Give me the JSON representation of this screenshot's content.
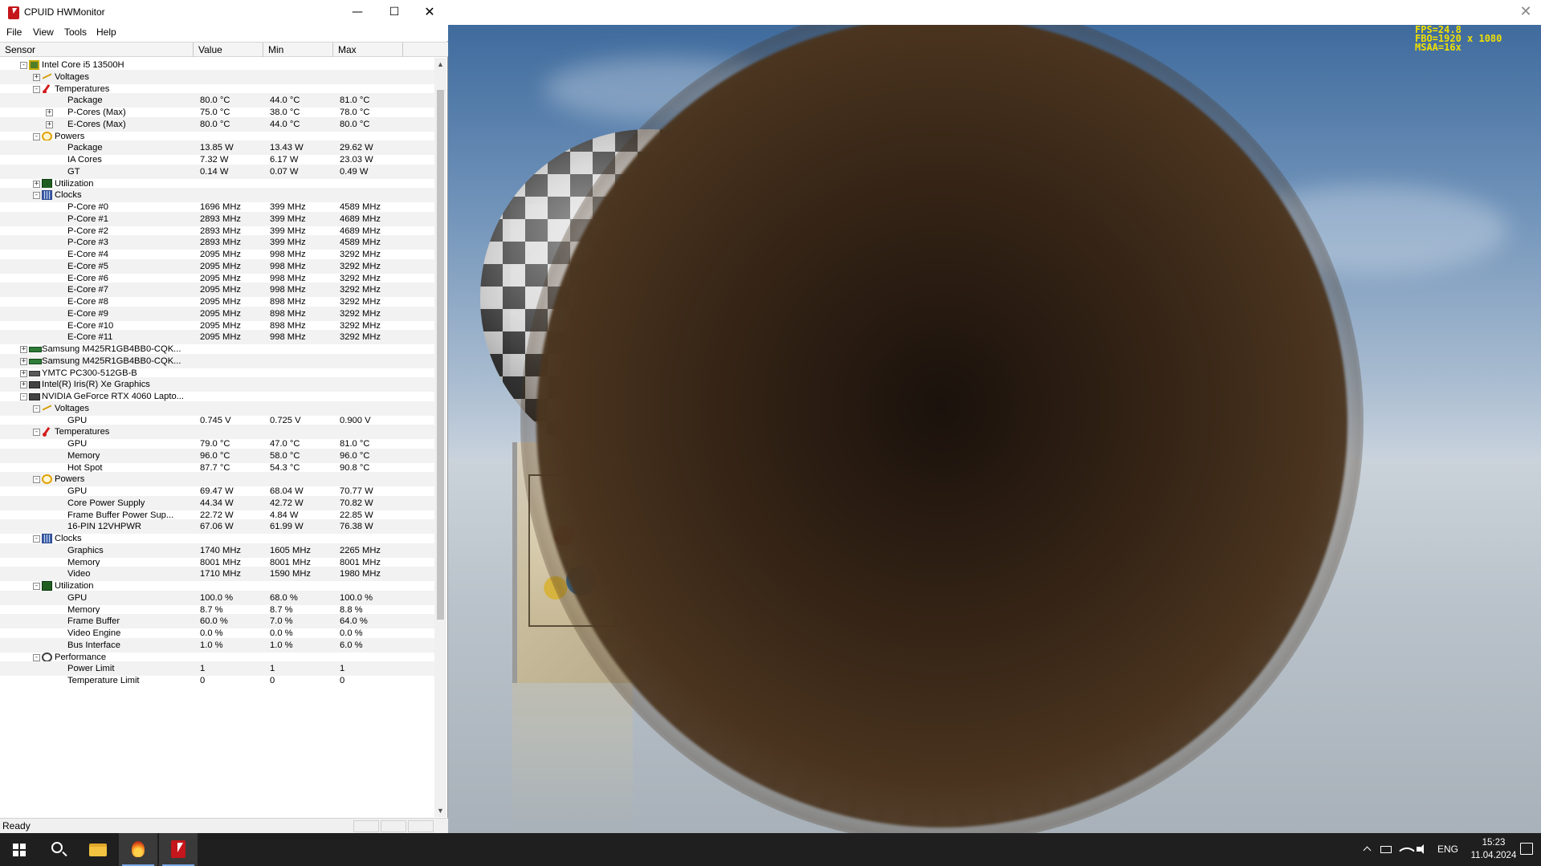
{
  "hwmonitor": {
    "title": "CPUID HWMonitor",
    "window_buttons": {
      "minimize": "—",
      "maximize": "☐",
      "close": "✕"
    },
    "menu": [
      "File",
      "View",
      "Tools",
      "Help"
    ],
    "columns": [
      "Sensor",
      "Value",
      "Min",
      "Max"
    ],
    "rows": [
      {
        "level": 1,
        "exp": "-",
        "icon": "cpu",
        "label": "Intel Core i5 13500H",
        "value": "",
        "min": "",
        "max": ""
      },
      {
        "level": 2,
        "exp": "+",
        "icon": "volt",
        "label": "Voltages",
        "value": "",
        "min": "",
        "max": ""
      },
      {
        "level": 2,
        "exp": "-",
        "icon": "temp",
        "label": "Temperatures",
        "value": "",
        "min": "",
        "max": ""
      },
      {
        "level": 3,
        "exp": "",
        "icon": "",
        "label": "Package",
        "value": "80.0 °C",
        "min": "44.0 °C",
        "max": "81.0 °C"
      },
      {
        "level": 3,
        "exp": "+",
        "icon": "",
        "label": "P-Cores (Max)",
        "value": "75.0 °C",
        "min": "38.0 °C",
        "max": "78.0 °C"
      },
      {
        "level": 3,
        "exp": "+",
        "icon": "",
        "label": "E-Cores (Max)",
        "value": "80.0 °C",
        "min": "44.0 °C",
        "max": "80.0 °C"
      },
      {
        "level": 2,
        "exp": "-",
        "icon": "power",
        "label": "Powers",
        "value": "",
        "min": "",
        "max": ""
      },
      {
        "level": 3,
        "exp": "",
        "icon": "",
        "label": "Package",
        "value": "13.85 W",
        "min": "13.43 W",
        "max": "29.62 W"
      },
      {
        "level": 3,
        "exp": "",
        "icon": "",
        "label": "IA Cores",
        "value": "7.32 W",
        "min": "6.17 W",
        "max": "23.03 W"
      },
      {
        "level": 3,
        "exp": "",
        "icon": "",
        "label": "GT",
        "value": "0.14 W",
        "min": "0.07 W",
        "max": "0.49 W"
      },
      {
        "level": 2,
        "exp": "+",
        "icon": "util",
        "label": "Utilization",
        "value": "",
        "min": "",
        "max": ""
      },
      {
        "level": 2,
        "exp": "-",
        "icon": "clock",
        "label": "Clocks",
        "value": "",
        "min": "",
        "max": ""
      },
      {
        "level": 3,
        "exp": "",
        "icon": "",
        "label": "P-Core #0",
        "value": "1696 MHz",
        "min": "399 MHz",
        "max": "4589 MHz"
      },
      {
        "level": 3,
        "exp": "",
        "icon": "",
        "label": "P-Core #1",
        "value": "2893 MHz",
        "min": "399 MHz",
        "max": "4689 MHz"
      },
      {
        "level": 3,
        "exp": "",
        "icon": "",
        "label": "P-Core #2",
        "value": "2893 MHz",
        "min": "399 MHz",
        "max": "4689 MHz"
      },
      {
        "level": 3,
        "exp": "",
        "icon": "",
        "label": "P-Core #3",
        "value": "2893 MHz",
        "min": "399 MHz",
        "max": "4589 MHz"
      },
      {
        "level": 3,
        "exp": "",
        "icon": "",
        "label": "E-Core #4",
        "value": "2095 MHz",
        "min": "998 MHz",
        "max": "3292 MHz"
      },
      {
        "level": 3,
        "exp": "",
        "icon": "",
        "label": "E-Core #5",
        "value": "2095 MHz",
        "min": "998 MHz",
        "max": "3292 MHz"
      },
      {
        "level": 3,
        "exp": "",
        "icon": "",
        "label": "E-Core #6",
        "value": "2095 MHz",
        "min": "998 MHz",
        "max": "3292 MHz"
      },
      {
        "level": 3,
        "exp": "",
        "icon": "",
        "label": "E-Core #7",
        "value": "2095 MHz",
        "min": "998 MHz",
        "max": "3292 MHz"
      },
      {
        "level": 3,
        "exp": "",
        "icon": "",
        "label": "E-Core #8",
        "value": "2095 MHz",
        "min": "898 MHz",
        "max": "3292 MHz"
      },
      {
        "level": 3,
        "exp": "",
        "icon": "",
        "label": "E-Core #9",
        "value": "2095 MHz",
        "min": "898 MHz",
        "max": "3292 MHz"
      },
      {
        "level": 3,
        "exp": "",
        "icon": "",
        "label": "E-Core #10",
        "value": "2095 MHz",
        "min": "898 MHz",
        "max": "3292 MHz"
      },
      {
        "level": 3,
        "exp": "",
        "icon": "",
        "label": "E-Core #11",
        "value": "2095 MHz",
        "min": "998 MHz",
        "max": "3292 MHz"
      },
      {
        "level": 1,
        "exp": "+",
        "icon": "ram",
        "label": "Samsung M425R1GB4BB0-CQK...",
        "value": "",
        "min": "",
        "max": ""
      },
      {
        "level": 1,
        "exp": "+",
        "icon": "ram",
        "label": "Samsung M425R1GB4BB0-CQK...",
        "value": "",
        "min": "",
        "max": ""
      },
      {
        "level": 1,
        "exp": "+",
        "icon": "disk",
        "label": "YMTC PC300-512GB-B",
        "value": "",
        "min": "",
        "max": ""
      },
      {
        "level": 1,
        "exp": "+",
        "icon": "gpu",
        "label": "Intel(R) Iris(R) Xe Graphics",
        "value": "",
        "min": "",
        "max": ""
      },
      {
        "level": 1,
        "exp": "-",
        "icon": "gpu",
        "label": "NVIDIA GeForce RTX 4060 Lapto...",
        "value": "",
        "min": "",
        "max": ""
      },
      {
        "level": 2,
        "exp": "-",
        "icon": "volt",
        "label": "Voltages",
        "value": "",
        "min": "",
        "max": ""
      },
      {
        "level": 3,
        "exp": "",
        "icon": "",
        "label": "GPU",
        "value": "0.745 V",
        "min": "0.725 V",
        "max": "0.900 V"
      },
      {
        "level": 2,
        "exp": "-",
        "icon": "temp",
        "label": "Temperatures",
        "value": "",
        "min": "",
        "max": ""
      },
      {
        "level": 3,
        "exp": "",
        "icon": "",
        "label": "GPU",
        "value": "79.0 °C",
        "min": "47.0 °C",
        "max": "81.0 °C"
      },
      {
        "level": 3,
        "exp": "",
        "icon": "",
        "label": "Memory",
        "value": "96.0 °C",
        "min": "58.0 °C",
        "max": "96.0 °C"
      },
      {
        "level": 3,
        "exp": "",
        "icon": "",
        "label": "Hot Spot",
        "value": "87.7 °C",
        "min": "54.3 °C",
        "max": "90.8 °C"
      },
      {
        "level": 2,
        "exp": "-",
        "icon": "power",
        "label": "Powers",
        "value": "",
        "min": "",
        "max": ""
      },
      {
        "level": 3,
        "exp": "",
        "icon": "",
        "label": "GPU",
        "value": "69.47 W",
        "min": "68.04 W",
        "max": "70.77 W"
      },
      {
        "level": 3,
        "exp": "",
        "icon": "",
        "label": "Core Power Supply",
        "value": "44.34 W",
        "min": "42.72 W",
        "max": "70.82 W"
      },
      {
        "level": 3,
        "exp": "",
        "icon": "",
        "label": "Frame Buffer Power Sup...",
        "value": "22.72 W",
        "min": "4.84 W",
        "max": "22.85 W"
      },
      {
        "level": 3,
        "exp": "",
        "icon": "",
        "label": "16-PIN 12VHPWR",
        "value": "67.06 W",
        "min": "61.99 W",
        "max": "76.38 W"
      },
      {
        "level": 2,
        "exp": "-",
        "icon": "clock",
        "label": "Clocks",
        "value": "",
        "min": "",
        "max": ""
      },
      {
        "level": 3,
        "exp": "",
        "icon": "",
        "label": "Graphics",
        "value": "1740 MHz",
        "min": "1605 MHz",
        "max": "2265 MHz"
      },
      {
        "level": 3,
        "exp": "",
        "icon": "",
        "label": "Memory",
        "value": "8001 MHz",
        "min": "8001 MHz",
        "max": "8001 MHz"
      },
      {
        "level": 3,
        "exp": "",
        "icon": "",
        "label": "Video",
        "value": "1710 MHz",
        "min": "1590 MHz",
        "max": "1980 MHz"
      },
      {
        "level": 2,
        "exp": "-",
        "icon": "util",
        "label": "Utilization",
        "value": "",
        "min": "",
        "max": ""
      },
      {
        "level": 3,
        "exp": "",
        "icon": "",
        "label": "GPU",
        "value": "100.0 %",
        "min": "68.0 %",
        "max": "100.0 %"
      },
      {
        "level": 3,
        "exp": "",
        "icon": "",
        "label": "Memory",
        "value": "8.7 %",
        "min": "8.7 %",
        "max": "8.8 %"
      },
      {
        "level": 3,
        "exp": "",
        "icon": "",
        "label": "Frame Buffer",
        "value": "60.0 %",
        "min": "7.0 %",
        "max": "64.0 %"
      },
      {
        "level": 3,
        "exp": "",
        "icon": "",
        "label": "Video Engine",
        "value": "0.0 %",
        "min": "0.0 %",
        "max": "0.0 %"
      },
      {
        "level": 3,
        "exp": "",
        "icon": "",
        "label": "Bus Interface",
        "value": "1.0 %",
        "min": "1.0 %",
        "max": "6.0 %"
      },
      {
        "level": 2,
        "exp": "-",
        "icon": "perf",
        "label": "Performance",
        "value": "",
        "min": "",
        "max": ""
      },
      {
        "level": 3,
        "exp": "",
        "icon": "",
        "label": "Power Limit",
        "value": "1",
        "min": "1",
        "max": "1"
      },
      {
        "level": 3,
        "exp": "",
        "icon": "",
        "label": "Temperature Limit",
        "value": "0",
        "min": "0",
        "max": "0"
      }
    ],
    "status": "Ready"
  },
  "scene": {
    "close": "✕",
    "overlay": [
      "FPS=24.8",
      "FBO=1920 x 1080",
      "MSAA=16x"
    ]
  },
  "taskbar": {
    "language": "ENG",
    "time": "15:23",
    "date": "11.04.2024"
  },
  "colors": {
    "overlay_text": "#f0e000",
    "taskbar_bg": "#1f1f1f",
    "row_alt": "#f2f2f2"
  }
}
